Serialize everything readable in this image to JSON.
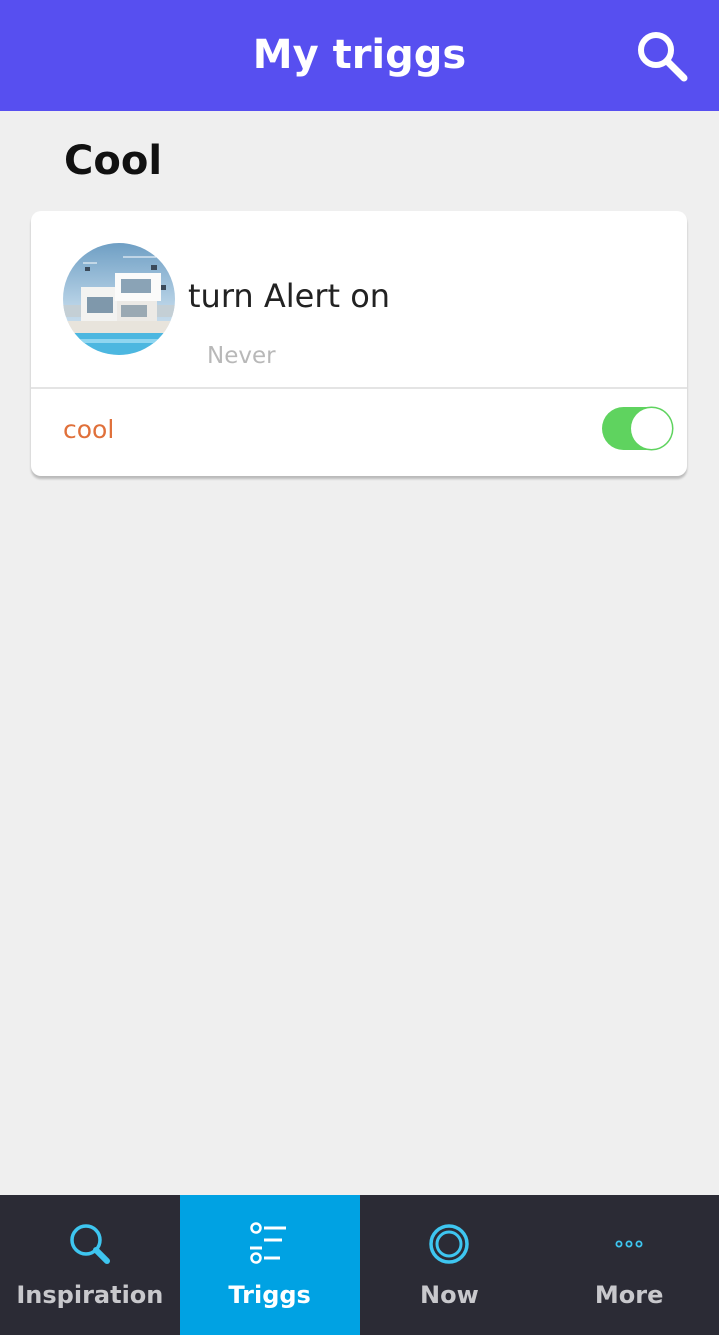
{
  "header": {
    "title": "My triggs",
    "search_icon": "search-icon",
    "background_color": "#574ff0"
  },
  "section": {
    "title": "Cool"
  },
  "trigg_card": {
    "name": "turn Alert on",
    "status": "Never",
    "group_label": "cool",
    "enabled": true,
    "toggle_color": "#5fd35f",
    "group_label_color": "#e0703a"
  },
  "bottom_nav": {
    "items": [
      {
        "label": "Inspiration",
        "icon": "search-icon",
        "active": false
      },
      {
        "label": "Triggs",
        "icon": "list-icon",
        "active": true
      },
      {
        "label": "Now",
        "icon": "ring-icon",
        "active": false
      },
      {
        "label": "More",
        "icon": "more-dots-icon",
        "active": false
      }
    ],
    "active_color": "#00a2e3",
    "background_color": "#2b2b35"
  }
}
